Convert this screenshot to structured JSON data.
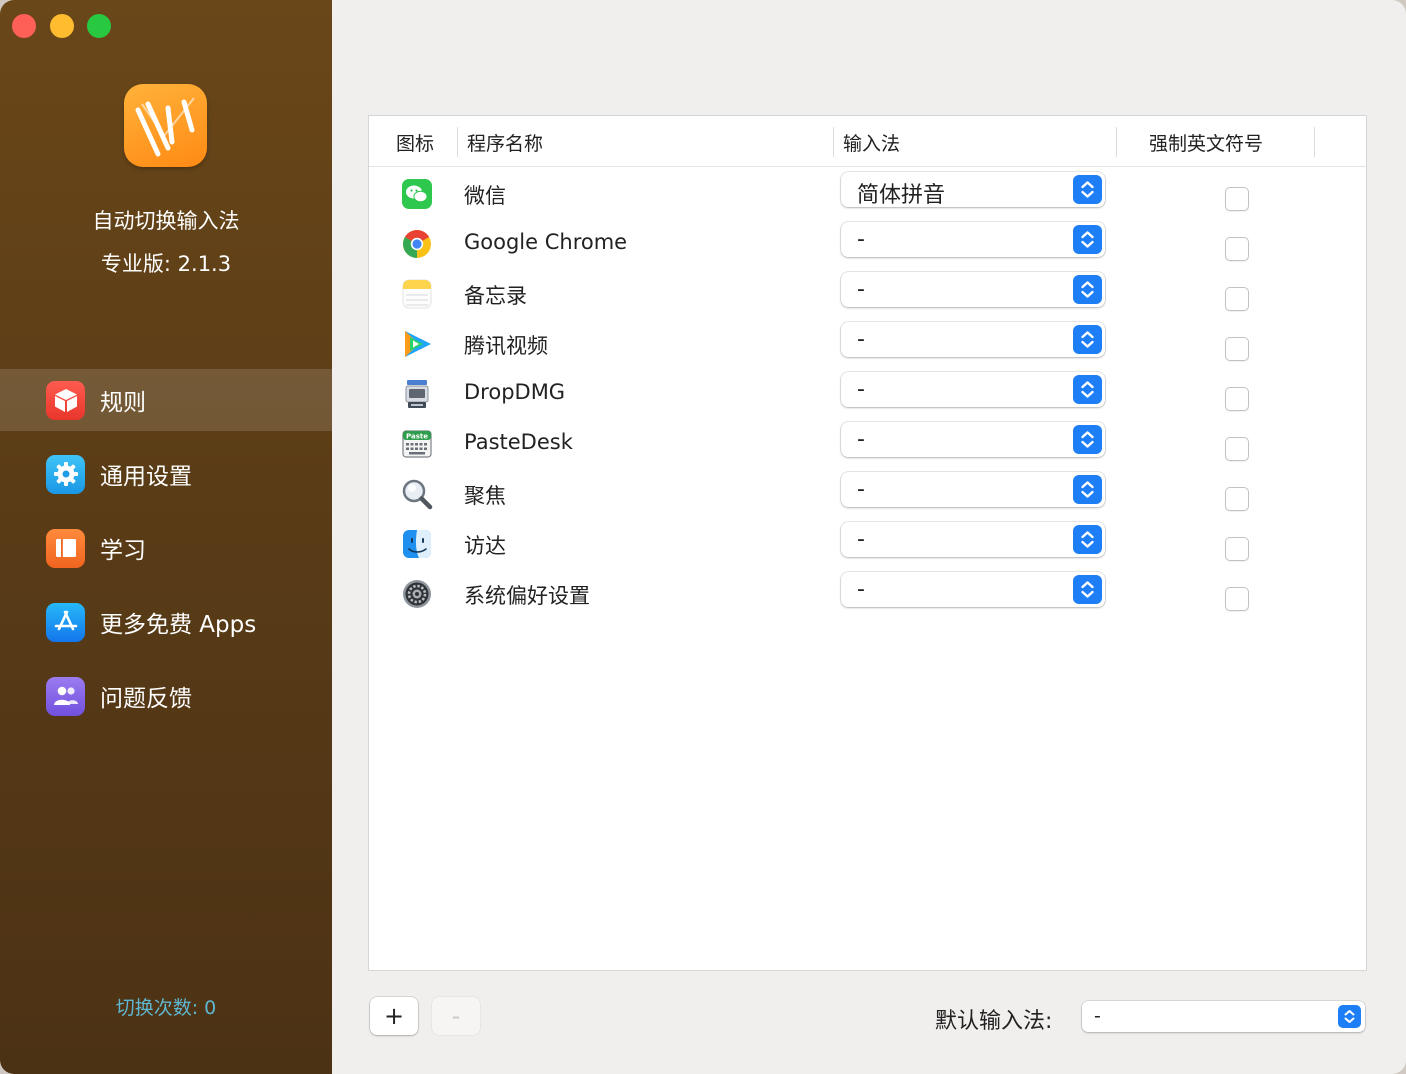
{
  "app": {
    "name": "自动切换输入法",
    "version": "专业版: 2.1.3",
    "accent": "#1e7ef6"
  },
  "sidebar": {
    "items": [
      {
        "label": "规则",
        "icon": "cube-icon",
        "active": true
      },
      {
        "label": "通用设置",
        "icon": "gear-icon",
        "active": false
      },
      {
        "label": "学习",
        "icon": "book-icon",
        "active": false
      },
      {
        "label": "更多免费 Apps",
        "icon": "app-store-icon",
        "active": false
      },
      {
        "label": "问题反馈",
        "icon": "people-icon",
        "active": false
      }
    ],
    "switch_count": "切换次数: 0"
  },
  "table": {
    "headers": {
      "icon": "图标",
      "name": "程序名称",
      "input_method": "输入法",
      "force_english": "强制英文符号"
    },
    "rows": [
      {
        "name": "微信",
        "icon": "wechat-icon",
        "input_method": "简体拼音",
        "force_english": false
      },
      {
        "name": "Google Chrome",
        "icon": "chrome-icon",
        "input_method": "-",
        "force_english": false
      },
      {
        "name": "备忘录",
        "icon": "notes-icon",
        "input_method": "-",
        "force_english": false
      },
      {
        "name": "腾讯视频",
        "icon": "tencent-video-icon",
        "input_method": "-",
        "force_english": false
      },
      {
        "name": "DropDMG",
        "icon": "dropdmg-icon",
        "input_method": "-",
        "force_english": false
      },
      {
        "name": "PasteDesk",
        "icon": "pastedesk-icon",
        "input_method": "-",
        "force_english": false,
        "icon_label": "Paste"
      },
      {
        "name": "聚焦",
        "icon": "spotlight-icon",
        "input_method": "-",
        "force_english": false
      },
      {
        "name": "访达",
        "icon": "finder-icon",
        "input_method": "-",
        "force_english": false
      },
      {
        "name": "系统偏好设置",
        "icon": "system-preferences-icon",
        "input_method": "-",
        "force_english": false
      }
    ]
  },
  "footer": {
    "add_label": "+",
    "remove_label": "-",
    "default_label": "默认输入法:",
    "default_value": "-"
  }
}
